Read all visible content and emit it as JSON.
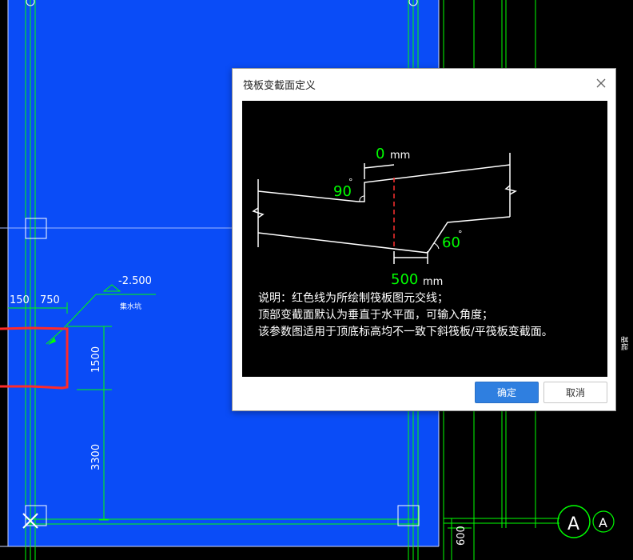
{
  "cad": {
    "dim_150": "150",
    "dim_750": "750",
    "elevation": "-2.500",
    "elevation_note": "集水坑",
    "dim_1500": "1500",
    "dim_3300": "3300",
    "dim_600": "600",
    "axis_label_big": "A",
    "axis_label_small": "A",
    "right_vertical_text": "基础",
    "colors": {
      "slab_fill": "#0a4cf7",
      "cad_line": "#00ff00",
      "red_line": "#ff2a2a"
    }
  },
  "dialog": {
    "title": "筏板变截面定义",
    "close_icon": "close-icon",
    "preview": {
      "top_offset_value": "0",
      "top_offset_unit": "mm",
      "angle_top": "90",
      "angle_bottom": "60",
      "degree_symbol": "°",
      "bottom_width_value": "500",
      "bottom_width_unit": "mm",
      "notes": [
        "说明：红色线为所绘制筏板图元交线；",
        "顶部变截面默认为垂直于水平面，可输入角度；",
        "该参数图适用于顶底标高均不一致下斜筏板/平筏板变截面。"
      ]
    },
    "ok_label": "确定",
    "cancel_label": "取消"
  }
}
